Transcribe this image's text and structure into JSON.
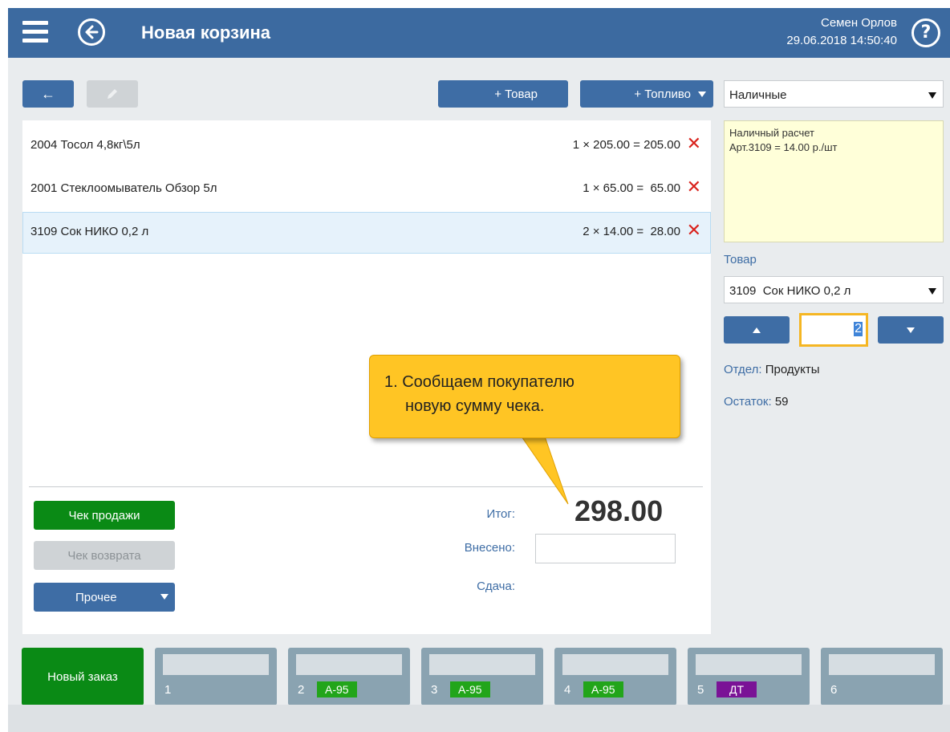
{
  "header": {
    "title": "Новая корзина",
    "user": "Семен Орлов",
    "datetime": "29.06.2018 14:50:40",
    "help": "?"
  },
  "toolbar": {
    "back_arrow": "←",
    "add_item": "+ Товар",
    "add_fuel": "+ Топливо"
  },
  "cart": {
    "items": [
      {
        "name": "2004 Тосол 4,8кг\\5л",
        "calc": "1 × 205.00 = 205.00"
      },
      {
        "name": "2001 Стеклоомыватель Обзор 5л",
        "calc": "1 × 65.00 =  65.00"
      },
      {
        "name": "3109 Сок НИКО 0,2 л",
        "calc": "2 × 14.00 =  28.00"
      }
    ],
    "delete_glyph": "✕",
    "selected_index": 2
  },
  "totals": {
    "total_label": "Итог:",
    "total_value": "298.00",
    "paid_label": "Внесено:",
    "paid_value": "",
    "change_label": "Сдача:"
  },
  "actions": {
    "sale_receipt": "Чек продажи",
    "return_receipt": "Чек возврата",
    "other": "Прочее"
  },
  "callout": {
    "line1": "1. Сообщаем покупателю",
    "line2": "новую сумму чека."
  },
  "sidebar": {
    "payment_method": "Наличные",
    "notes_line1": "Наличный расчет",
    "notes_line2": "Арт.3109 = 14.00 р./шт",
    "item_label": "Товар",
    "item_value": "3109  Сок НИКО 0,2 л",
    "quantity": "2",
    "department_label": "Отдел:",
    "department_value": "Продукты",
    "stock_label": "Остаток:",
    "stock_value": "59"
  },
  "orders": {
    "new_order": "Новый заказ",
    "slots": [
      {
        "num": "1",
        "fuel": "",
        "color": ""
      },
      {
        "num": "2",
        "fuel": "А-95",
        "color": "#22a51a"
      },
      {
        "num": "3",
        "fuel": "А-95",
        "color": "#22a51a"
      },
      {
        "num": "4",
        "fuel": "А-95",
        "color": "#22a51a"
      },
      {
        "num": "5",
        "fuel": "ДТ",
        "color": "#7a1296"
      },
      {
        "num": "6",
        "fuel": "",
        "color": ""
      }
    ]
  },
  "colors": {
    "header_bg": "#3c6aa0",
    "primary": "#3e6da5",
    "success": "#0a8a15",
    "delete": "#d9221c",
    "callout": "#ffc524"
  }
}
